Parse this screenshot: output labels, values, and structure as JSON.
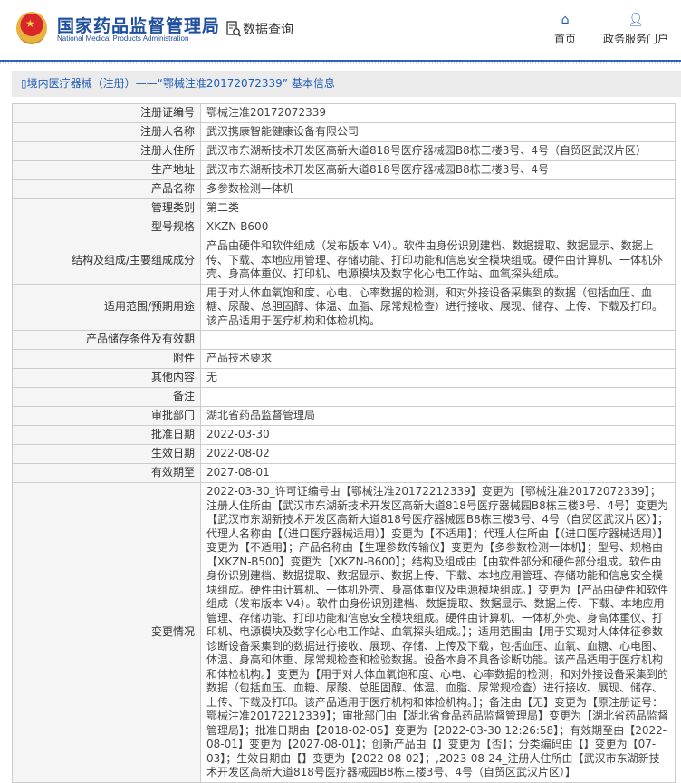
{
  "header": {
    "logo_cn": "国家药品监督管理局",
    "logo_en": "National Medical Products Administration",
    "query": "数据查询",
    "nav": [
      {
        "label": "首页",
        "icon": "home-icon"
      },
      {
        "label": "政务服务门户",
        "icon": "user-icon"
      }
    ]
  },
  "title": "境内医疗器械（注册）——“鄂械注准20172072339” 基本信息",
  "rows": [
    {
      "label": "注册证编号",
      "value": "鄂械注准20172072339"
    },
    {
      "label": "注册人名称",
      "value": "武汉携康智能健康设备有限公司"
    },
    {
      "label": "注册人住所",
      "value": "武汉市东湖新技术开发区高新大道818号医疗器械园B8栋三楼3号、4号（自贸区武汉片区）"
    },
    {
      "label": "生产地址",
      "value": "武汉市东湖新技术开发区高新大道818号医疗器械园B8栋三楼3号、4号"
    },
    {
      "label": "产品名称",
      "value": "多参数检测一体机"
    },
    {
      "label": "管理类别",
      "value": "第二类"
    },
    {
      "label": "型号规格",
      "value": "XKZN-B600"
    },
    {
      "label": "结构及组成/主要组成成分",
      "value": "产品由硬件和软件组成（发布版本 V4）。软件由身份识别建档、数据提取、数据显示、数据上传、下载、本地应用管理、存储功能、打印功能和信息安全模块组成。硬件由计算机、一体机外壳、身高体重仪、打印机、电源模块及数字化心电工作站、血氧探头组成。"
    },
    {
      "label": "适用范围/预期用途",
      "value": "用于对人体血氧饱和度、心电、心率数据的检测，和对外接设备采集到的数据（包括血压、血糖、尿酸、总胆固醇、体温、血脂、尿常规检查）进行接收、展现、储存、上传、下载及打印。该产品适用于医疗机构和体检机构。"
    },
    {
      "label": "产品储存条件及有效期",
      "value": ""
    },
    {
      "label": "附件",
      "value": "产品技术要求"
    },
    {
      "label": "其他内容",
      "value": "无"
    },
    {
      "label": "备注",
      "value": ""
    },
    {
      "label": "审批部门",
      "value": "湖北省药品监督管理局"
    },
    {
      "label": "批准日期",
      "value": "2022-03-30"
    },
    {
      "label": "生效日期",
      "value": "2022-08-02"
    },
    {
      "label": "有效期至",
      "value": "2027-08-01"
    },
    {
      "label": "变更情况",
      "value": "2022-03-30_许可证编号由【鄂械注准20172212339】变更为【鄂械注准20172072339】；注册人住所由【武汉市东湖新技术开发区高新大道818号医疗器械园B8栋三楼3号、4号】变更为【武汉市东湖新技术开发区高新大道818号医疗器械园B8栋三楼3号、4号（自贸区武汉片区）】；代理人名称由【（进口医疗器械适用）】变更为【不适用】；代理人住所由【（进口医疗器械适用）】变更为【不适用】；产品名称由【生理参数传输仪】变更为【多参数检测一体机】；型号、规格由【XKZN-B500】变更为【XKZN-B600】；结构及组成由【由软件部分和硬件部分组成。软件由身份识别建档、数据提取、数据显示、数据上传、下载、本地应用管理、存储功能和信息安全模块组成。硬件由计算机、一体机外壳、身高体重仪及电源模块组成。】变更为【产品由硬件和软件组成（发布版本 V4）。软件由身份识别建档、数据提取、数据显示、数据上传、下载、本地应用管理、存储功能、打印功能和信息安全模块组成。硬件由计算机、一体机外壳、身高体重仪、打印机、电源模块及数字化心电工作站、血氧探头组成。】；适用范围由【用于实现对人体体征参数诊断设备采集到的数据进行接收、展现、存储、上传及下载，包括血压、血氧、血糖、心电图、体温、身高和体重、尿常规检查和检验数据。设备本身不具备诊断功能。该产品适用于医疗机构和体检机构。】变更为【用于对人体血氧饱和度、心电、心率数据的检测，和对外接设备采集到的数据（包括血压、血糖、尿酸、总胆固醇、体温、血脂、尿常规检查）进行接收、展现、储存、上传、下载及打印。该产品适用于医疗机构和体检机构。】；备注由【无】变更为【原注册证号：鄂械注准20172212339】；审批部门由【湖北省食品药品监督管理局】变更为【湖北省药品监督管理局】；批准日期由【2018-02-05】变更为【2022-03-30 12:26:58】；有效期至由【2022-08-01】变更为【2027-08-01】；创新产品由【】变更为【否】；分类编码由【】变更为【07-03】；生效日期由【】变更为【2022-08-02】；,2023-08-24_注册人住所由【武汉市东湖新技术开发区高新大道818号医疗器械园B8栋三楼3号、4号（自贸区武汉片区）】"
    }
  ]
}
